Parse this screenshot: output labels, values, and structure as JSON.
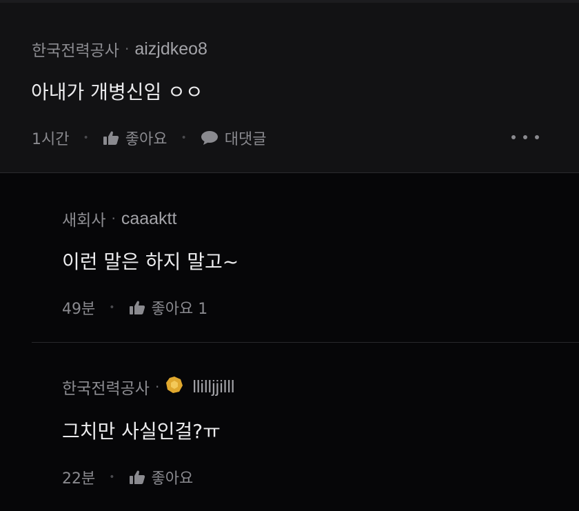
{
  "top_comment": {
    "author": "한국전력공사",
    "separator": "·",
    "nickname": "aizjdkeo8",
    "text": "아내가 개병신임 ㅇㅇ",
    "time": "1시간",
    "like_label": "좋아요",
    "reply_label": "대댓글",
    "more_icon": "more-dots-icon"
  },
  "replies": [
    {
      "author": "새회사",
      "separator": "·",
      "nickname": "caaaktt",
      "text": "이런 말은 하지 말고~",
      "time": "49분",
      "like_label": "좋아요 1"
    },
    {
      "author": "한국전력공사",
      "separator": "·",
      "badge_icon": "gold-badge-icon",
      "badge_color": "#e0a82e",
      "nickname": "llilljjilll",
      "text": "그치만 사실인걸?ㅠ",
      "time": "22분",
      "like_label": "좋아요"
    }
  ]
}
